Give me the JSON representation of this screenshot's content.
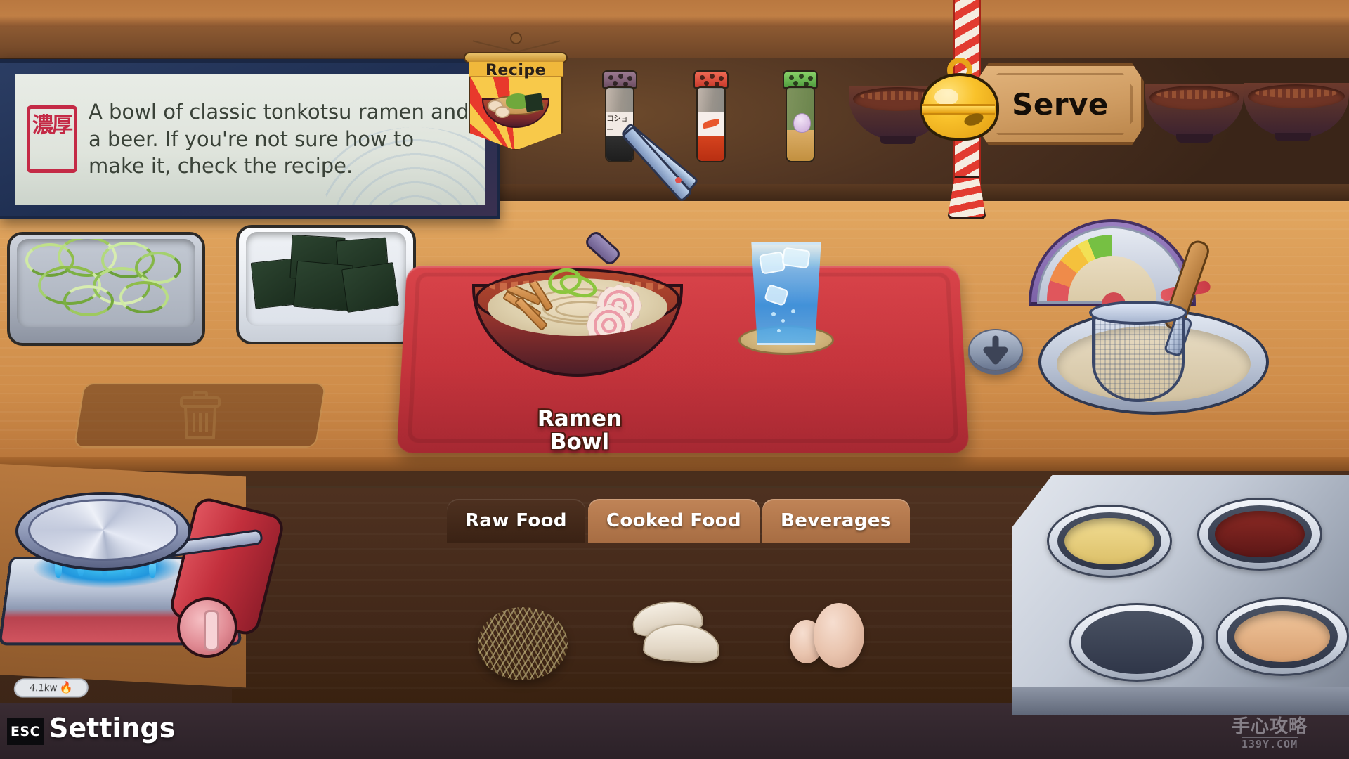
{
  "order": {
    "stamp_text": "濃厚",
    "text": "A bowl of classic tonkotsu ramen and a beer. If you're not sure how to make it, check the recipe."
  },
  "recipe": {
    "label": "Recipe"
  },
  "serve": {
    "label": "Serve"
  },
  "shelf": {
    "shakers": [
      {
        "name": "pepper-shaker",
        "label": "コショー",
        "cap_color": "#7e5d72",
        "fill_color": "#2b2b2b"
      },
      {
        "name": "chili-shaker",
        "label": "",
        "cap_color": "#e2503f",
        "fill_color": "#d4371f"
      },
      {
        "name": "garlic-shaker",
        "label": "",
        "cap_color": "#6cbd54",
        "fill_color": "#d8a45c"
      }
    ]
  },
  "counter": {
    "trays": [
      {
        "name": "green-onion-tray",
        "contents": "green onions"
      },
      {
        "name": "nori-tray",
        "contents": "nori seaweed"
      }
    ],
    "trash_zone": "trash-drop-zone",
    "plated_item": {
      "label_line1": "Ramen",
      "label_line2": "Bowl"
    },
    "beverage": "water glass with ice",
    "tool": "tongs holding green onions"
  },
  "gauge": {
    "name": "heat-gauge",
    "needle_zone": "red",
    "segments": [
      "#e0565c",
      "#ef8b4a",
      "#f5c13c",
      "#f2e055",
      "#76c043"
    ]
  },
  "stove_left": {
    "power_label": "4.1kw",
    "flame_on": true
  },
  "stovetop_right": {
    "pots": [
      {
        "name": "broth-pot-shio",
        "color": "#e4c873",
        "filled": true
      },
      {
        "name": "broth-pot-shoyu",
        "color": "#6d1f1f",
        "filled": true
      },
      {
        "name": "broth-pot-empty",
        "color": "",
        "filled": false
      },
      {
        "name": "broth-pot-tonkotsu",
        "color": "#e2ae82",
        "filled": true
      }
    ]
  },
  "tabs": [
    {
      "label": "Raw Food",
      "active": true
    },
    {
      "label": "Cooked Food",
      "active": false
    },
    {
      "label": "Beverages",
      "active": false
    }
  ],
  "food_items": [
    {
      "name": "noodles-item",
      "label": "noodles"
    },
    {
      "name": "dumplings-item",
      "label": "dumplings"
    },
    {
      "name": "eggs-item",
      "label": "eggs"
    }
  ],
  "hud": {
    "esc_key": "ESC",
    "settings_label": "Settings"
  },
  "watermark": {
    "main": "手心攻略",
    "sub": "139Y.COM"
  }
}
